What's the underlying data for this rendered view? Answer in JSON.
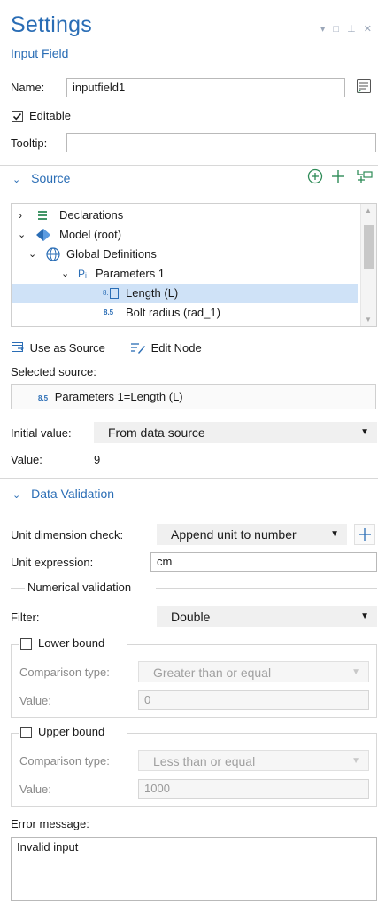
{
  "header": {
    "title": "Settings",
    "subtitle": "Input Field",
    "window_controls": [
      "chevron-down-icon",
      "maximize-icon",
      "pin-icon",
      "close-icon"
    ]
  },
  "name_field": {
    "label": "Name:",
    "value": "inputfield1"
  },
  "editable": {
    "label": "Editable",
    "checked": true
  },
  "tooltip_field": {
    "label": "Tooltip:",
    "value": ""
  },
  "source_section": {
    "title": "Source",
    "tree": [
      {
        "label": "Declarations",
        "icon": "declarations-icon",
        "expander": "collapsed"
      },
      {
        "label": "Model (root)",
        "icon": "model-icon",
        "expander": "expanded"
      },
      {
        "label": "Global Definitions",
        "icon": "globe-icon",
        "expander": "expanded"
      },
      {
        "label": "Parameters 1",
        "icon_text": "Pᵢ",
        "expander": "expanded"
      },
      {
        "label": "Length (L)",
        "icon_text": "8.5",
        "selected": true
      },
      {
        "label": "Bolt radius (rad_1)",
        "icon_text": "8.5"
      }
    ],
    "use_as_source": "Use as Source",
    "edit_node": "Edit Node",
    "selected_source_label": "Selected source:",
    "selected_source_icon": "8.5",
    "selected_source_value": "Parameters 1=Length (L)"
  },
  "initial_value": {
    "label": "Initial value:",
    "value": "From data source"
  },
  "value_row": {
    "label": "Value:",
    "value": "9"
  },
  "data_validation": {
    "title": "Data Validation",
    "unit_dimension_check": {
      "label": "Unit dimension check:",
      "value": "Append unit to number"
    },
    "unit_expression": {
      "label": "Unit expression:",
      "value": "cm"
    },
    "numerical_validation_title": "Numerical validation",
    "filter": {
      "label": "Filter:",
      "value": "Double"
    },
    "lower_bound": {
      "label": "Lower bound",
      "checked": false,
      "comparison_label": "Comparison type:",
      "comparison_value": "Greater than or equal",
      "value_label": "Value:",
      "value": "0"
    },
    "upper_bound": {
      "label": "Upper bound",
      "checked": false,
      "comparison_label": "Comparison type:",
      "comparison_value": "Less than or equal",
      "value_label": "Value:",
      "value": "1000"
    },
    "error_message": {
      "label": "Error message:",
      "value": "Invalid input"
    }
  },
  "colors": {
    "accent": "#2a6db5",
    "selection": "#cfe2f7",
    "add_green": "#2e8b57"
  }
}
